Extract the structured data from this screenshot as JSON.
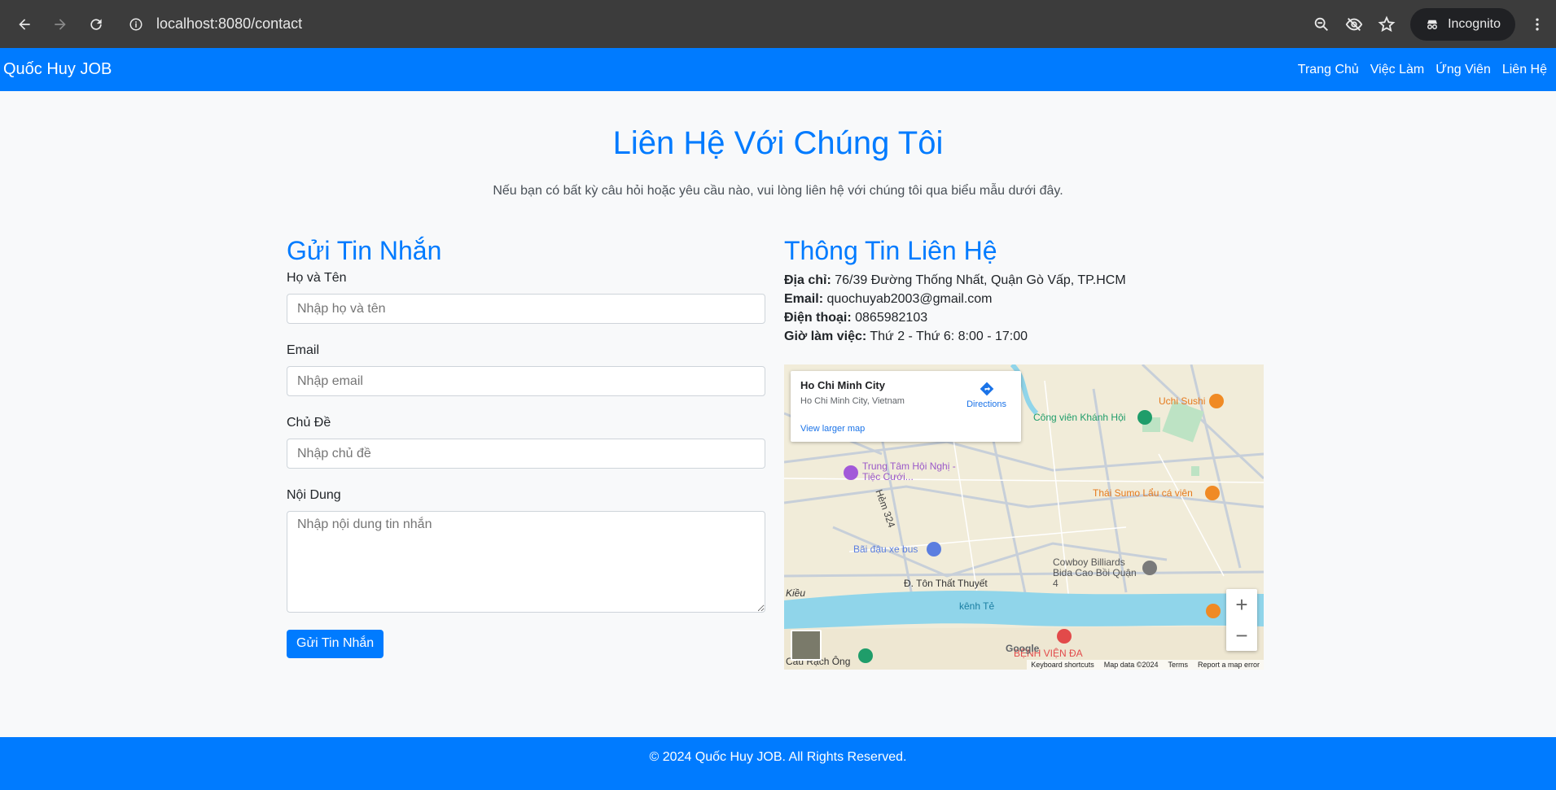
{
  "browser": {
    "url": "localhost:8080/contact",
    "incognito_label": "Incognito"
  },
  "navbar": {
    "brand": "Quốc Huy JOB",
    "links": [
      "Trang Chủ",
      "Việc Làm",
      "Ứng Viên",
      "Liên Hệ"
    ]
  },
  "page": {
    "title": "Liên Hệ Với Chúng Tôi",
    "subtitle": "Nếu bạn có bất kỳ câu hỏi hoặc yêu cầu nào, vui lòng liên hệ với chúng tôi qua biểu mẫu dưới đây."
  },
  "form": {
    "heading": "Gửi Tin Nhắn",
    "name_label": "Họ và Tên",
    "name_placeholder": "Nhập họ và tên",
    "email_label": "Email",
    "email_placeholder": "Nhập email",
    "subject_label": "Chủ Đề",
    "subject_placeholder": "Nhập chủ đề",
    "message_label": "Nội Dung",
    "message_placeholder": "Nhập nội dung tin nhắn",
    "submit_label": "Gửi Tin Nhắn"
  },
  "contact": {
    "heading": "Thông Tin Liên Hệ",
    "address_label": "Địa chỉ:",
    "address": "76/39 Đường Thống Nhất, Quận Gò Vấp, TP.HCM",
    "email_label": "Email:",
    "email": "quochuyab2003@gmail.com",
    "phone_label": "Điện thoại:",
    "phone": "0865982103",
    "hours_label": "Giờ làm việc:",
    "hours": "Thứ 2 - Thứ 6: 8:00 - 17:00"
  },
  "map": {
    "place_name": "Ho Chi Minh City",
    "place_addr": "Ho Chi Minh City, Vietnam",
    "directions": "Directions",
    "larger_map": "View larger map",
    "labels": {
      "park": "Công viên Khánh Hội",
      "sushi": "Uchi Sushi",
      "convention": "Trung Tâm Hội Nghị - Tiệc Cưới...",
      "hotpot": "Thái Sumo Lẩu cá viên",
      "bus": "Bãi đậu xe bus",
      "billiards": "Cowboy Billiards Bida Cao Bồi Quận 4",
      "street": "Đ. Tôn Thất Thuyết",
      "canal": "kênh Tẻ",
      "hospital": "BỆNH VIỆN ĐA",
      "alley": "Hẻm 324",
      "kieu": "Kiều",
      "bridge": "Cầu Rạch Ông"
    },
    "footer": [
      "Keyboard shortcuts",
      "Map data ©2024",
      "Terms",
      "Report a map error"
    ],
    "google": "Google"
  },
  "footer": {
    "text": "© 2024 Quốc Huy JOB. All Rights Reserved."
  }
}
